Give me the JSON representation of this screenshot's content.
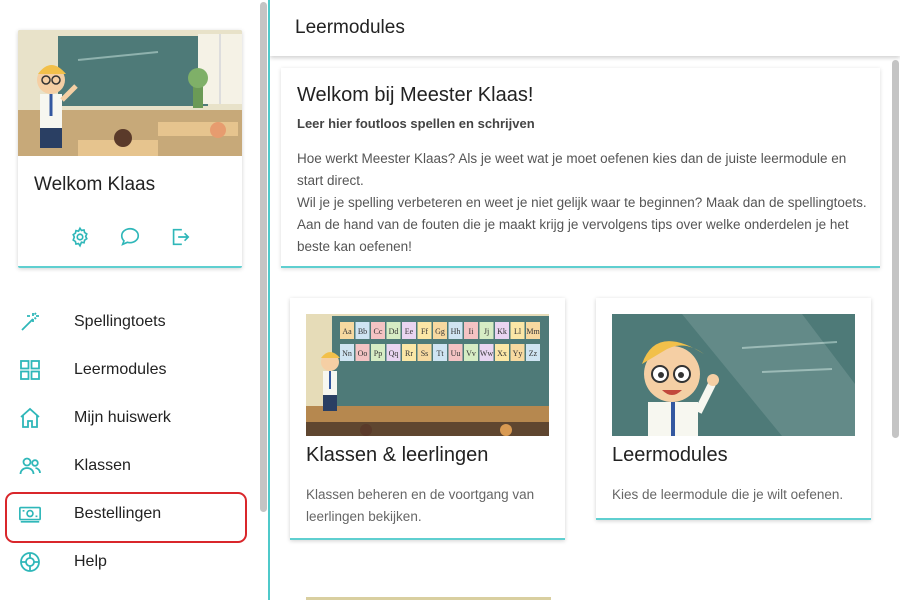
{
  "sidebar": {
    "profile": {
      "name": "Welkom Klaas"
    },
    "actions": [
      {
        "icon": "settings-icon"
      },
      {
        "icon": "chat-icon"
      },
      {
        "icon": "logout-icon"
      }
    ],
    "items": [
      {
        "label": "Spellingtoets",
        "icon": "magic-wand-icon"
      },
      {
        "label": "Leermodules",
        "icon": "grid-icon"
      },
      {
        "label": "Mijn huiswerk",
        "icon": "home-icon"
      },
      {
        "label": "Klassen",
        "icon": "users-icon"
      },
      {
        "label": "Bestellingen",
        "icon": "money-icon",
        "highlighted": true
      },
      {
        "label": "Help",
        "icon": "lifebuoy-icon"
      }
    ]
  },
  "header": {
    "title": "Leermodules"
  },
  "welcome": {
    "title": "Welkom bij Meester Klaas!",
    "subtitle": "Leer hier foutloos spellen en schrijven",
    "paragraph1": "Hoe werkt Meester Klaas? Als je weet wat je moet oefenen kies dan de juiste leermodule en start direct.",
    "paragraph2": "Wil je je spelling verbeteren en weet je niet gelijk waar te beginnen? Maak dan de spellingtoets. Aan de hand van de fouten die je maakt krijg je vervolgens tips over welke onderdelen je het beste kan oefenen!"
  },
  "cards": [
    {
      "title": "Klassen & leerlingen",
      "description": "Klassen beheren en de voortgang van leerlingen bekijken."
    },
    {
      "title": "Leermodules",
      "description": "Kies de leermodule die je wilt oefenen."
    }
  ],
  "alphabet": [
    "Aa",
    "Bb",
    "Cc",
    "Dd",
    "Ee",
    "Ff",
    "Gg",
    "Hh",
    "Ii",
    "Jj",
    "Kk",
    "Ll",
    "Mm",
    "Nn",
    "Oo",
    "Pp",
    "Qq",
    "Rr",
    "Ss",
    "Tt",
    "Uu",
    "Vv",
    "Ww",
    "Xx",
    "Yy",
    "Zz"
  ],
  "colors": {
    "accent": "#4fc9ca",
    "highlight": "#d9262b",
    "chalkboard": "#4e7a78"
  }
}
